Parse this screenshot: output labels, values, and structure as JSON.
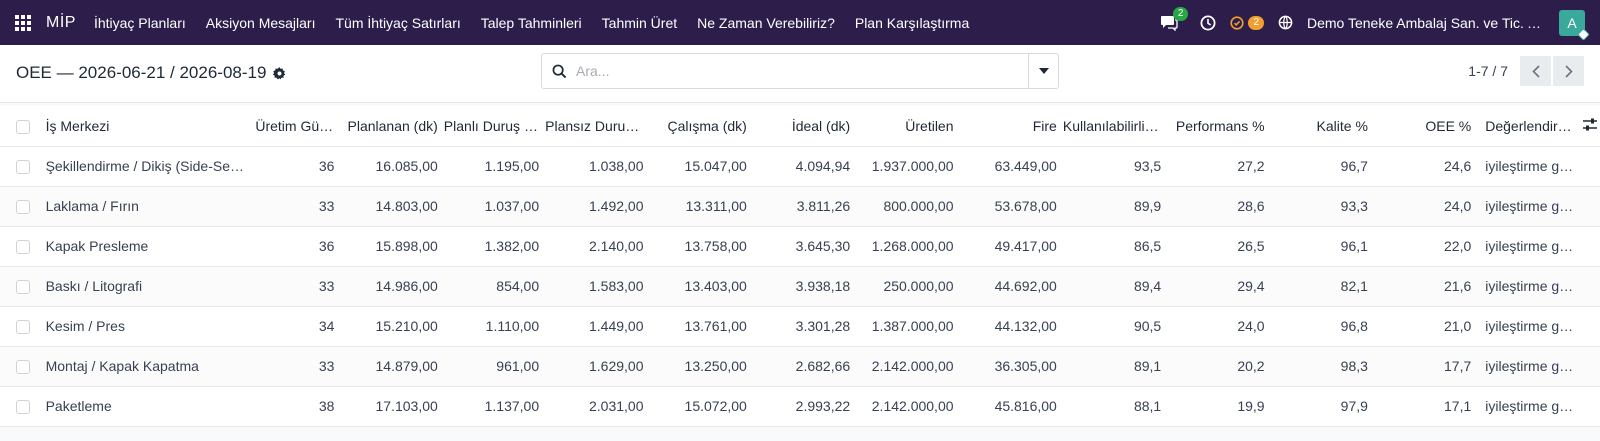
{
  "navbar": {
    "brand": "MİP",
    "menu": [
      "İhtiyaç Planları",
      "Aksiyon Mesajları",
      "Tüm İhtiyaç Satırları",
      "Talep Tahminleri",
      "Tahmin Üret",
      "Ne Zaman Verebiliriz?",
      "Plan Karşılaştırma"
    ],
    "messages_count": "2",
    "activities_count": "2",
    "company": "Demo Teneke Ambalaj San. ve Tic. A.Ş.",
    "avatar_letter": "A",
    "colors": {
      "background": "#2c1d4b",
      "badge_green": "#28a745",
      "badge_orange": "#f0a030",
      "avatar": "#3aa89a"
    }
  },
  "control_panel": {
    "title": "OEE — 2026-06-21 / 2026-08-19",
    "search_placeholder": "Ara...",
    "pager": "1-7 / 7"
  },
  "table": {
    "columns": [
      "İş Merkezi",
      "Üretim Günü",
      "Planlanan (dk)",
      "Planlı Duruş (dk)",
      "Plansız Duruş (dk)",
      "Çalışma (dk)",
      "İdeal (dk)",
      "Üretilen",
      "Fire",
      "Kullanılabilirlik %",
      "Performans %",
      "Kalite %",
      "OEE %",
      "Değerlendirme"
    ],
    "rows": [
      [
        "Şekillendirme / Dikiş (Side-Seam)",
        "36",
        "16.085,00",
        "1.195,00",
        "1.038,00",
        "15.047,00",
        "4.094,94",
        "1.937.000,00",
        "63.449,00",
        "93,5",
        "27,2",
        "96,7",
        "24,6",
        "iyileştirme gerekli"
      ],
      [
        "Laklama / Fırın",
        "33",
        "14.803,00",
        "1.037,00",
        "1.492,00",
        "13.311,00",
        "3.811,26",
        "800.000,00",
        "53.678,00",
        "89,9",
        "28,6",
        "93,3",
        "24,0",
        "iyileştirme gerekli"
      ],
      [
        "Kapak Presleme",
        "36",
        "15.898,00",
        "1.382,00",
        "2.140,00",
        "13.758,00",
        "3.645,30",
        "1.268.000,00",
        "49.417,00",
        "86,5",
        "26,5",
        "96,1",
        "22,0",
        "iyileştirme gerekli"
      ],
      [
        "Baskı / Litografi",
        "33",
        "14.986,00",
        "854,00",
        "1.583,00",
        "13.403,00",
        "3.938,18",
        "250.000,00",
        "44.692,00",
        "89,4",
        "29,4",
        "82,1",
        "21,6",
        "iyileştirme gerekli"
      ],
      [
        "Kesim / Pres",
        "34",
        "15.210,00",
        "1.110,00",
        "1.449,00",
        "13.761,00",
        "3.301,28",
        "1.387.000,00",
        "44.132,00",
        "90,5",
        "24,0",
        "96,8",
        "21,0",
        "iyileştirme gerekli"
      ],
      [
        "Montaj / Kapak Kapatma",
        "33",
        "14.879,00",
        "961,00",
        "1.629,00",
        "13.250,00",
        "2.682,66",
        "2.142.000,00",
        "36.305,00",
        "89,1",
        "20,2",
        "98,3",
        "17,7",
        "iyileştirme gerekli"
      ],
      [
        "Paketleme",
        "38",
        "17.103,00",
        "1.137,00",
        "2.031,00",
        "15.072,00",
        "2.993,22",
        "2.142.000,00",
        "45.816,00",
        "88,1",
        "19,9",
        "97,9",
        "17,1",
        "iyileştirme gerekli"
      ]
    ]
  }
}
